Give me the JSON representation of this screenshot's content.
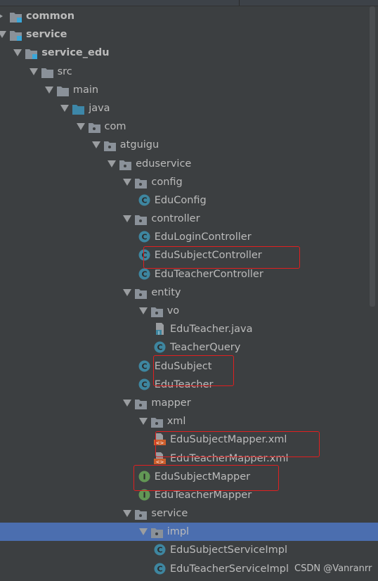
{
  "tree": [
    {
      "label": "common",
      "level": 0,
      "icon": "module-folder-icon",
      "expanded": false,
      "bold": true
    },
    {
      "label": "service",
      "level": 0,
      "icon": "module-folder-icon",
      "expanded": true,
      "bold": true
    },
    {
      "label": "service_edu",
      "level": 1,
      "icon": "module-folder-icon",
      "expanded": true,
      "bold": true
    },
    {
      "label": "src",
      "level": 2,
      "icon": "folder-icon",
      "expanded": true
    },
    {
      "label": "main",
      "level": 3,
      "icon": "folder-icon",
      "expanded": true
    },
    {
      "label": "java",
      "level": 4,
      "icon": "source-folder-icon",
      "expanded": true
    },
    {
      "label": "com",
      "level": 5,
      "icon": "package-icon",
      "expanded": true
    },
    {
      "label": "atguigu",
      "level": 6,
      "icon": "package-icon",
      "expanded": true
    },
    {
      "label": "eduservice",
      "level": 7,
      "icon": "package-icon",
      "expanded": true
    },
    {
      "label": "config",
      "level": 8,
      "icon": "package-icon",
      "expanded": true
    },
    {
      "label": "EduConfig",
      "level": 9,
      "icon": "class-icon"
    },
    {
      "label": "controller",
      "level": 8,
      "icon": "package-icon",
      "expanded": true
    },
    {
      "label": "EduLoginController",
      "level": 9,
      "icon": "class-icon"
    },
    {
      "label": "EduSubjectController",
      "level": 9,
      "icon": "class-icon",
      "highlight": true
    },
    {
      "label": "EduTeacherController",
      "level": 9,
      "icon": "class-icon"
    },
    {
      "label": "entity",
      "level": 8,
      "icon": "package-icon",
      "expanded": true
    },
    {
      "label": "vo",
      "level": 9,
      "icon": "package-icon",
      "expanded": true
    },
    {
      "label": "EduTeacher.java",
      "level": 10,
      "icon": "java-file-icon"
    },
    {
      "label": "TeacherQuery",
      "level": 10,
      "icon": "class-icon"
    },
    {
      "label": "EduSubject",
      "level": 9,
      "icon": "class-icon",
      "highlight": true
    },
    {
      "label": "EduTeacher",
      "level": 9,
      "icon": "class-icon"
    },
    {
      "label": "mapper",
      "level": 8,
      "icon": "package-icon",
      "expanded": true
    },
    {
      "label": "xml",
      "level": 9,
      "icon": "package-icon",
      "expanded": true
    },
    {
      "label": "EduSubjectMapper.xml",
      "level": 10,
      "icon": "xml-file-icon",
      "highlight": true
    },
    {
      "label": "EduTeacherMapper.xml",
      "level": 10,
      "icon": "xml-file-icon"
    },
    {
      "label": "EduSubjectMapper",
      "level": 9,
      "icon": "interface-icon",
      "highlight": true
    },
    {
      "label": "EduTeacherMapper",
      "level": 9,
      "icon": "interface-icon"
    },
    {
      "label": "service",
      "level": 8,
      "icon": "package-icon",
      "expanded": true
    },
    {
      "label": "impl",
      "level": 9,
      "icon": "package-icon",
      "expanded": true,
      "selected": true
    },
    {
      "label": "EduSubjectServiceImpl",
      "level": 10,
      "icon": "class-icon"
    },
    {
      "label": "EduTeacherServiceImpl",
      "level": 10,
      "icon": "class-icon"
    }
  ],
  "watermark": "CSDN @Vanranrr",
  "colors": {
    "background": "#3c3f41",
    "text": "#bbbbbb",
    "selection": "#4b6eaf",
    "highlight_box": "#e02020",
    "class": "#3e86a0",
    "interface": "#629755",
    "xml": "#cc5e2c",
    "folder": "#8a9199",
    "source_folder": "#3d87a8"
  }
}
